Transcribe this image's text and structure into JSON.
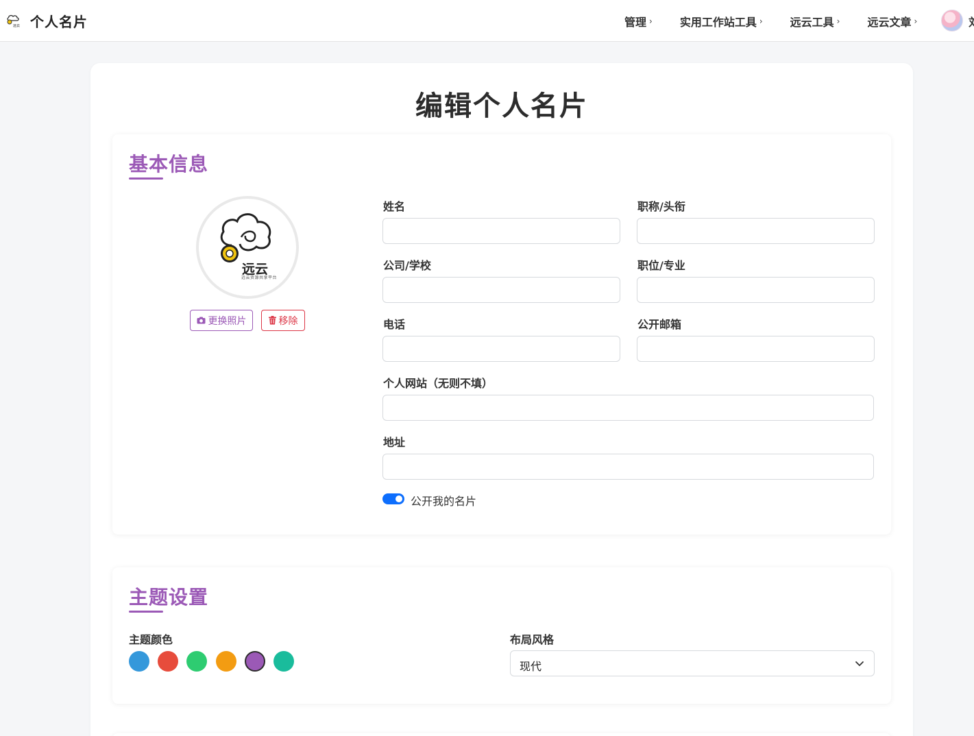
{
  "header": {
    "brand_title": "个人名片",
    "nav": [
      {
        "label": "管理",
        "chevron": "›"
      },
      {
        "label": "实用工作站工具",
        "chevron": "›"
      },
      {
        "label": "远云工具",
        "chevron": "›"
      },
      {
        "label": "远云文章",
        "chevron": "›"
      }
    ],
    "user_name_partial": "刘"
  },
  "page_title": "编辑个人名片",
  "basic_info": {
    "title": "基本信息",
    "photo": {
      "logo_text": "远云",
      "logo_subtext": "远云资源共享平台",
      "change_label": "更换照片",
      "remove_label": "移除",
      "change_icon": "camera-icon",
      "remove_icon": "trash-icon"
    },
    "fields": {
      "name": {
        "label": "姓名",
        "value": ""
      },
      "title": {
        "label": "职称/头衔",
        "value": ""
      },
      "company": {
        "label": "公司/学校",
        "value": ""
      },
      "position": {
        "label": "职位/专业",
        "value": ""
      },
      "phone": {
        "label": "电话",
        "value": ""
      },
      "email": {
        "label": "公开邮箱",
        "value": ""
      },
      "website": {
        "label": "个人网站（无则不填）",
        "value": ""
      },
      "address": {
        "label": "地址",
        "value": ""
      }
    },
    "public_toggle": {
      "label": "公开我的名片",
      "checked": true
    }
  },
  "theme": {
    "title": "主题设置",
    "color_label": "主题颜色",
    "colors": [
      "#3498db",
      "#e74c3c",
      "#2ecc71",
      "#f39c12",
      "#9b59b6",
      "#1abc9c"
    ],
    "selected_color": "#9b59b6",
    "layout_label": "布局风格",
    "layout_value": "现代"
  },
  "accent": {
    "purple": "#9b59b6",
    "danger": "#dc3545",
    "toggle": "#0d6efd"
  }
}
